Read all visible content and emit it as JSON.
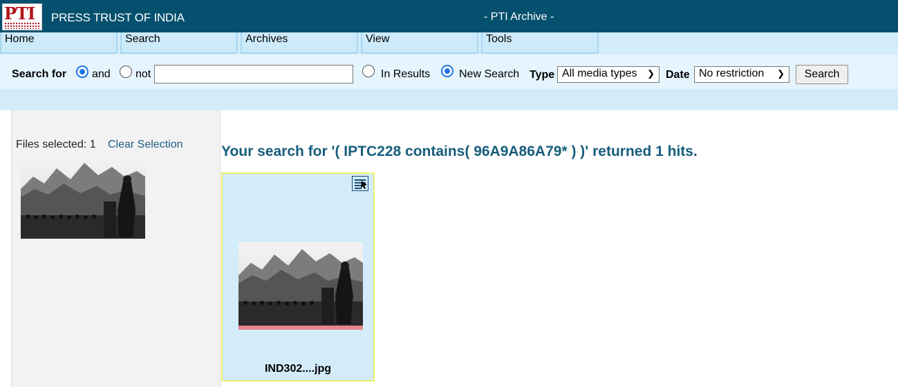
{
  "header": {
    "brand": "PRESS TRUST OF INDIA",
    "app_title": "- PTI Archive -",
    "logo_text": "PTI"
  },
  "menu": {
    "items": [
      "Home",
      "Search",
      "Archives",
      "View",
      "Tools"
    ]
  },
  "search": {
    "label": "Search for",
    "and_label": "and",
    "not_label": "not",
    "query_value": "",
    "in_results_label": "In Results",
    "new_search_label": "New Search",
    "type_label": "Type",
    "type_value": "All media types",
    "date_label": "Date",
    "date_value": "No restriction",
    "button_label": "Search",
    "selected_mode": "and",
    "selected_scope": "New Search"
  },
  "sidebar": {
    "files_selected": "Files selected: 1",
    "clear_selection": "Clear Selection"
  },
  "results": {
    "heading": "Your search for '( IPTC228 contains( 96A9A86A79* ) )' returned 1 hits.",
    "items": [
      {
        "filename": "IND302....jpg"
      }
    ]
  },
  "colors": {
    "header_bg": "#04506e",
    "menu_bg": "#cdeafb",
    "heading": "#175d7c",
    "card_border": "#eef06a",
    "card_bar": "#e7838c"
  }
}
